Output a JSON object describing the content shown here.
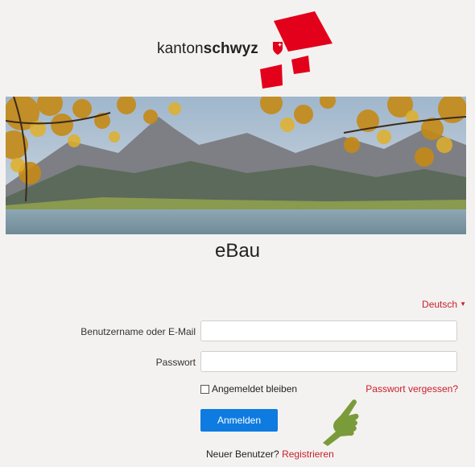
{
  "header": {
    "logo_text_light": "kanton",
    "logo_text_bold": "schwyz"
  },
  "app": {
    "title": "eBau"
  },
  "language": {
    "selected": "Deutsch"
  },
  "login_form": {
    "username_label": "Benutzername oder E-Mail",
    "username_value": "",
    "password_label": "Passwort",
    "password_value": "",
    "remember_label": "Angemeldet bleiben",
    "forgot_link": "Passwort vergessen?",
    "submit_label": "Anmelden",
    "new_user_text": "Neuer Benutzer?",
    "register_link": "Registrieren"
  },
  "colors": {
    "accent_red": "#c8202b",
    "button_blue": "#0e7be0",
    "background": "#f4f2f1",
    "hand_green": "#7a9b3a"
  },
  "icons": {
    "brand_marks": "red-squares-icon",
    "shield": "schwyz-shield-icon",
    "caret": "caret-down-icon",
    "pointer": "pointing-hand-icon"
  }
}
